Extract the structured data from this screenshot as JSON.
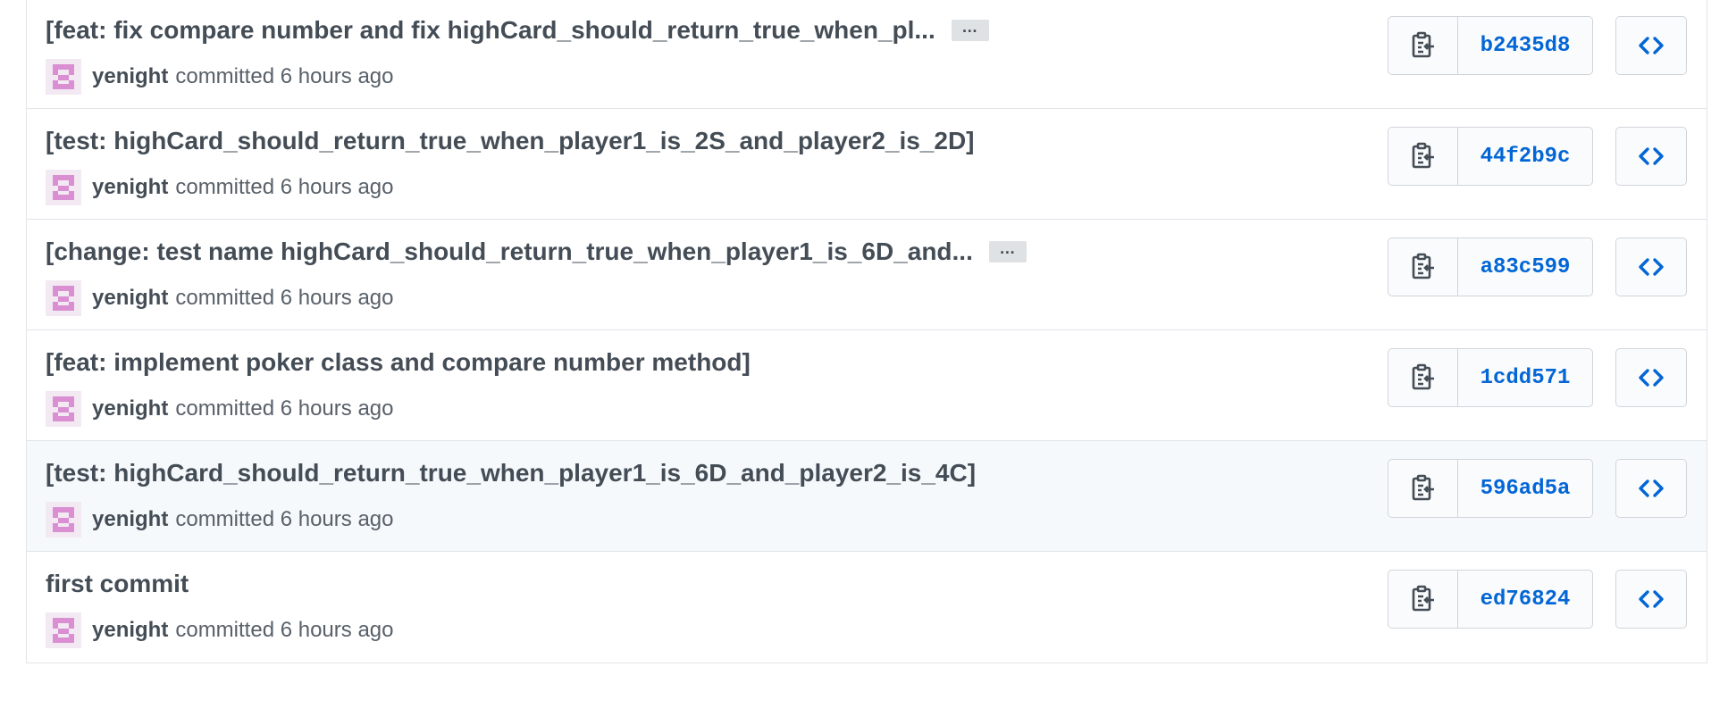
{
  "commits": [
    {
      "title": "[feat: fix compare number and fix highCard_should_return_true_when_pl...",
      "has_ellipsis": true,
      "ellipsis_label": "…",
      "author": "yenight",
      "action": "committed",
      "time": "6 hours ago",
      "sha": "b2435d8",
      "highlighted": false
    },
    {
      "title": "[test: highCard_should_return_true_when_player1_is_2S_and_player2_is_2D]",
      "has_ellipsis": false,
      "ellipsis_label": "",
      "author": "yenight",
      "action": "committed",
      "time": "6 hours ago",
      "sha": "44f2b9c",
      "highlighted": false
    },
    {
      "title": "[change: test name highCard_should_return_true_when_player1_is_6D_and...",
      "has_ellipsis": true,
      "ellipsis_label": "…",
      "author": "yenight",
      "action": "committed",
      "time": "6 hours ago",
      "sha": "a83c599",
      "highlighted": false
    },
    {
      "title": "[feat: implement poker class and compare number method]",
      "has_ellipsis": false,
      "ellipsis_label": "",
      "author": "yenight",
      "action": "committed",
      "time": "6 hours ago",
      "sha": "1cdd571",
      "highlighted": false
    },
    {
      "title": "[test: highCard_should_return_true_when_player1_is_6D_and_player2_is_4C]",
      "has_ellipsis": false,
      "ellipsis_label": "",
      "author": "yenight",
      "action": "committed",
      "time": "6 hours ago",
      "sha": "596ad5a",
      "highlighted": true
    },
    {
      "title": "first commit",
      "has_ellipsis": false,
      "ellipsis_label": "",
      "author": "yenight",
      "action": "committed",
      "time": "6 hours ago",
      "sha": "ed76824",
      "highlighted": false
    }
  ],
  "icons": {
    "copy": "clipboard-copy-icon",
    "browse": "code-brackets-icon",
    "avatar": "identicon-avatar"
  },
  "colors": {
    "sha_link": "#0366d6",
    "avatar_pink": "#d98fd1",
    "highlight_row": "#f6f9fc"
  }
}
